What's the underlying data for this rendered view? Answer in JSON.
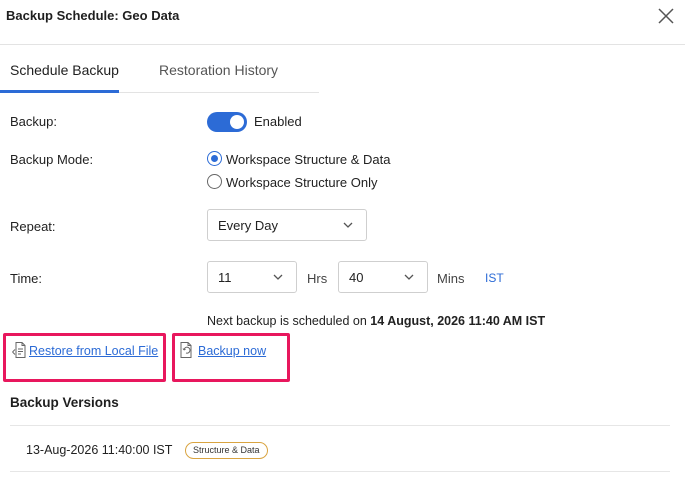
{
  "dialog": {
    "title": "Backup Schedule: Geo Data"
  },
  "tabs": [
    {
      "label": "Schedule Backup",
      "active": true
    },
    {
      "label": "Restoration History",
      "active": false
    }
  ],
  "form": {
    "backup_label": "Backup:",
    "backup_toggle_text": "Enabled",
    "backup_enabled": true,
    "mode_label": "Backup Mode:",
    "mode_options": [
      {
        "label": "Workspace Structure & Data",
        "selected": true
      },
      {
        "label": "Workspace Structure Only",
        "selected": false
      }
    ],
    "repeat_label": "Repeat:",
    "repeat_value": "Every Day",
    "time_label": "Time:",
    "hours_value": "11",
    "hours_unit": "Hrs",
    "mins_value": "40",
    "mins_unit": "Mins",
    "timezone": "IST"
  },
  "next_backup": {
    "prefix": "Next backup is scheduled on ",
    "datetime": "14 August, 2026 11:40 AM IST"
  },
  "actions": {
    "restore_local": "Restore from Local File",
    "backup_now": "Backup now"
  },
  "versions": {
    "title": "Backup Versions",
    "items": [
      {
        "time": "13-Aug-2026 11:40:00 IST",
        "badge": "Structure & Data"
      }
    ]
  },
  "colors": {
    "accent": "#2c6bd6",
    "highlight": "#e8175d",
    "badge_border": "#d9a441"
  },
  "icons": {
    "close": "close-icon",
    "chevron": "chevron-down-icon",
    "restore": "restore-file-icon",
    "backup": "backup-now-icon"
  }
}
